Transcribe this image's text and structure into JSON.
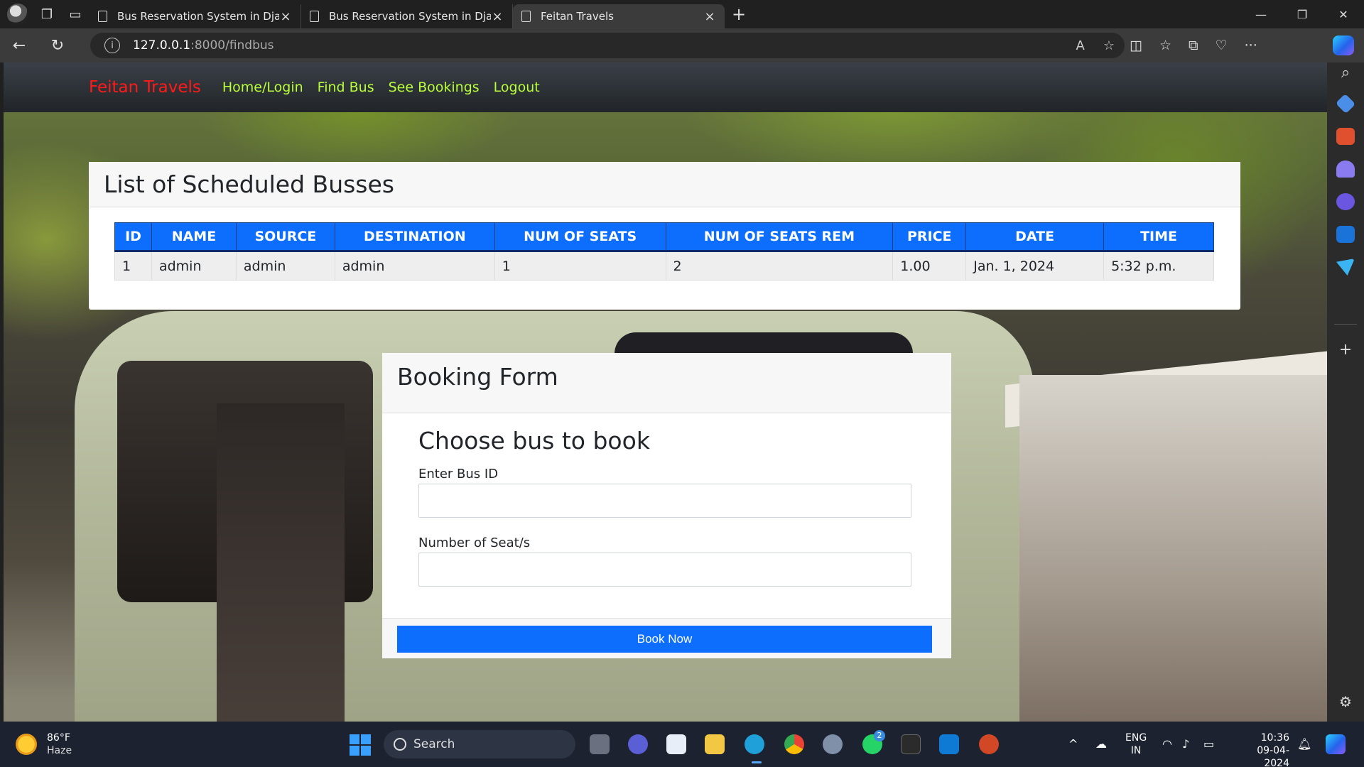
{
  "browser": {
    "tabs": [
      {
        "title": "Bus Reservation System in Djang",
        "active": false
      },
      {
        "title": "Bus Reservation System in Djang",
        "active": false
      },
      {
        "title": "Feitan Travels",
        "active": true
      }
    ],
    "url_host": "127.0.0.1",
    "url_path": ":8000/findbus"
  },
  "navbar": {
    "brand": "Feitan Travels",
    "links": [
      "Home/Login",
      "Find Bus",
      "See Bookings",
      "Logout"
    ]
  },
  "schedule": {
    "title": "List of Scheduled Busses",
    "columns": [
      "ID",
      "NAME",
      "SOURCE",
      "DESTINATION",
      "NUM OF SEATS",
      "NUM OF SEATS REM",
      "PRICE",
      "DATE",
      "TIME"
    ],
    "rows": [
      [
        "1",
        "admin",
        "admin",
        "admin",
        "1",
        "2",
        "1.00",
        "Jan. 1, 2024",
        "5:32 p.m."
      ]
    ]
  },
  "booking": {
    "header": "Booking Form",
    "subtitle": "Choose bus to book",
    "bus_id_label": "Enter Bus ID",
    "bus_id_value": "",
    "seats_label": "Number of Seat/s",
    "seats_value": "",
    "submit_label": "Book Now"
  },
  "taskbar": {
    "temperature": "86°F",
    "weather": "Haze",
    "search_placeholder": "Search",
    "whatsapp_badge": "2",
    "lang_top": "ENG",
    "lang_bottom": "IN",
    "time": "10:36",
    "date": "09-04-2024"
  },
  "colors": {
    "primary": "#0d6efd",
    "brand": "#ff1a1a",
    "nav_link": "#b8ff3a",
    "navbar_bg": "#343a40"
  }
}
